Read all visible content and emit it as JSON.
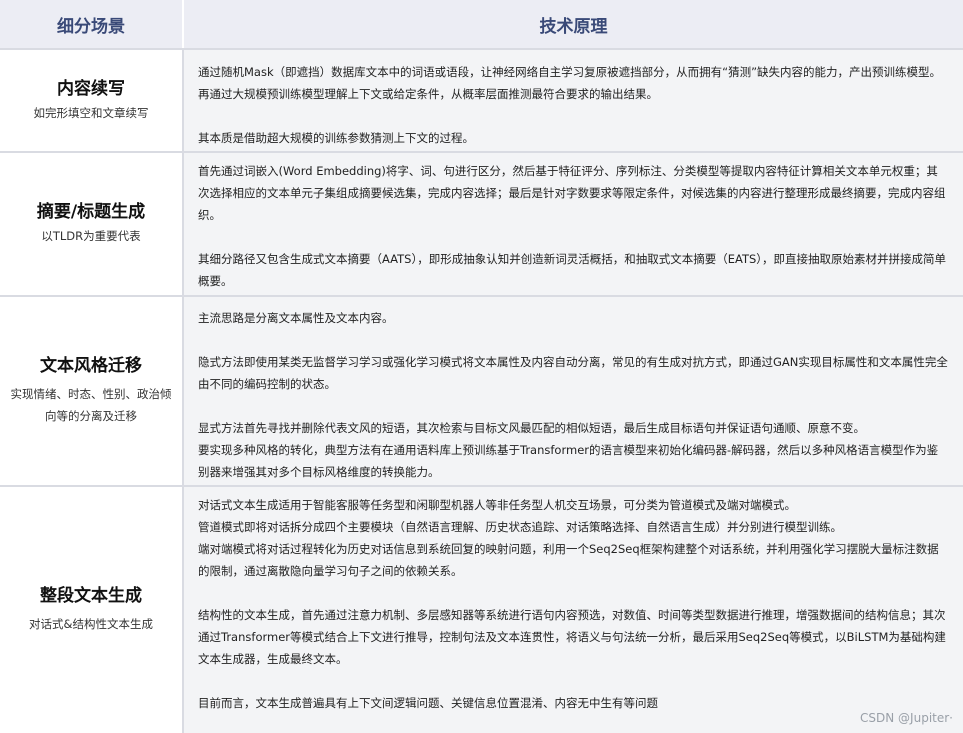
{
  "header": {
    "col1": "细分场景",
    "col2": "技术原理"
  },
  "rows": [
    {
      "title": "内容续写",
      "subtitle": "如完形填空和文章续写",
      "paras": [
        "通过随机Mask（即遮挡）数据库文本中的词语或语段，让神经网络自主学习复原被遮挡部分，从而拥有“猜测”缺失内容的能力，产出预训练模型。再通过大规模预训练模型理解上下文或给定条件，从概率层面推测最符合要求的输出结果。",
        "",
        "其本质是借助超大规模的训练参数猜测上下文的过程。"
      ]
    },
    {
      "title": "摘要/标题生成",
      "subtitle": "以TLDR为重要代表",
      "paras": [
        "首先通过词嵌入(Word Embedding)将字、词、句进行区分，然后基于特征评分、序列标注、分类模型等提取内容特征计算相关文本单元权重；其次选择相应的文本单元子集组成摘要候选集，完成内容选择；最后是针对字数要求等限定条件，对候选集的内容进行整理形成最终摘要，完成内容组织。",
        "",
        "其细分路径又包含生成式文本摘要（AATS），即形成抽象认知并创造新词灵活概括，和抽取式文本摘要（EATS），即直接抽取原始素材并拼接成简单概要。"
      ]
    },
    {
      "title": "文本风格迁移",
      "subtitle": "实现情绪、时态、性别、政治倾向等的分离及迁移",
      "paras": [
        "主流思路是分离文本属性及文本内容。",
        "",
        "隐式方法即使用某类无监督学习学习或强化学习模式将文本属性及内容自动分离，常见的有生成对抗方式，即通过GAN实现目标属性和文本属性完全由不同的编码控制的状态。",
        "",
        "显式方法首先寻找并删除代表文风的短语，其次检索与目标文风最匹配的相似短语，最后生成目标语句并保证语句通顺、原意不变。",
        "要实现多种风格的转化，典型方法有在通用语料库上预训练基于Transformer的语言模型来初始化编码器-解码器，然后以多种风格语言模型作为鉴别器来增强其对多个目标风格维度的转换能力。"
      ]
    },
    {
      "title": "整段文本生成",
      "subtitle": "对话式&结构性文本生成",
      "paras": [
        "对话式文本生成适用于智能客服等任务型和闲聊型机器人等非任务型人机交互场景，可分类为管道模式及端对端模式。",
        "管道模式即将对话拆分成四个主要模块（自然语言理解、历史状态追踪、对话策略选择、自然语言生成）并分别进行模型训练。",
        "端对端模式将对话过程转化为历史对话信息到系统回复的映射问题，利用一个Seq2Seq框架构建整个对话系统，并利用强化学习摆脱大量标注数据的限制，通过离散隐向量学习句子之间的依赖关系。",
        "",
        "结构性的文本生成，首先通过注意力机制、多层感知器等系统进行语句内容预选，对数值、时间等类型数据进行推理，增强数据间的结构信息；其次通过Transformer等模式结合上下文进行推导，控制句法及文本连贯性，将语义与句法统一分析，最后采用Seq2Seq等模式，以BiLSTM为基础构建文本生成器，生成最终文本。",
        "",
        "目前而言，文本生成普遍具有上下文间逻辑问题、关键信息位置混淆、内容无中生有等问题"
      ]
    }
  ],
  "watermark": "CSDN @Jupiter·"
}
